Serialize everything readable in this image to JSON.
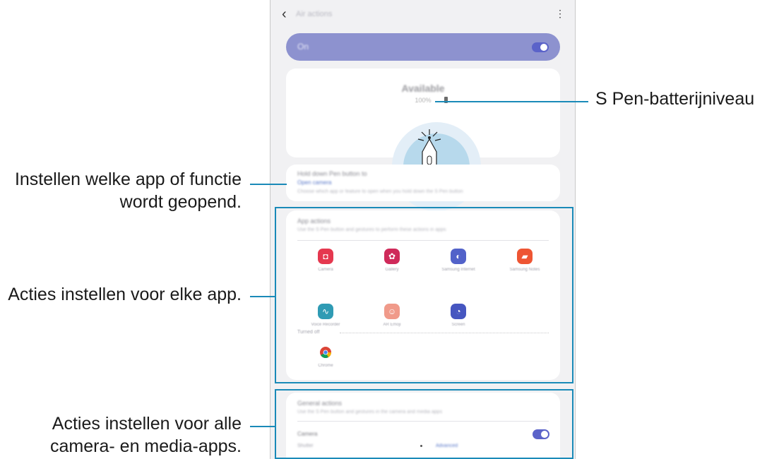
{
  "annotations": {
    "battery_level": "S Pen-batterijniveau",
    "set_app_line1": "Instellen welke app of functie",
    "set_app_line2": "wordt geopend.",
    "app_actions": "Acties instellen voor elke app.",
    "general_line1": "Acties instellen voor alle",
    "general_line2": "camera- en media-apps."
  },
  "screen": {
    "title": "Air actions",
    "on_label": "On",
    "status_title": "Available",
    "battery_text": "100%",
    "open_card": {
      "title": "Hold down Pen button to",
      "link": "Open camera",
      "desc": "Choose which app or feature to open when you hold down the S Pen button"
    },
    "app_actions": {
      "title": "App actions",
      "desc": "Use the S Pen button and gestures to perform these actions in apps",
      "apps": [
        {
          "label": "Camera",
          "icon": "camera-icon",
          "color": "#e5384f",
          "glyph": "◘"
        },
        {
          "label": "Gallery",
          "icon": "gallery-icon",
          "color": "#cf2a5a",
          "glyph": "✿"
        },
        {
          "label": "Samsung Internet",
          "icon": "internet-icon",
          "color": "#5262c9",
          "glyph": "◐"
        },
        {
          "label": "Samsung Notes",
          "icon": "notes-icon",
          "color": "#ee5533",
          "glyph": "▰"
        },
        {
          "label": "Voice Recorder",
          "icon": "recorder-icon",
          "color": "#2f9bb4",
          "glyph": "∿"
        },
        {
          "label": "AR Emoji",
          "icon": "ar-emoji-icon",
          "color": "#f09a8a",
          "glyph": "☺"
        },
        {
          "label": "Screen",
          "icon": "screen-icon",
          "color": "#4656c0",
          "glyph": "◔"
        }
      ],
      "group_label": "Turned off",
      "extra_apps": [
        {
          "label": "Chrome",
          "icon": "chrome-icon",
          "color": "#ffffff",
          "glyph": ""
        }
      ]
    },
    "general": {
      "title": "General actions",
      "desc": "Use the S Pen button and gestures in the camera and media apps",
      "camera_label": "Camera",
      "shutter_label": "Shutter",
      "shutter_link": "Advanced"
    }
  }
}
